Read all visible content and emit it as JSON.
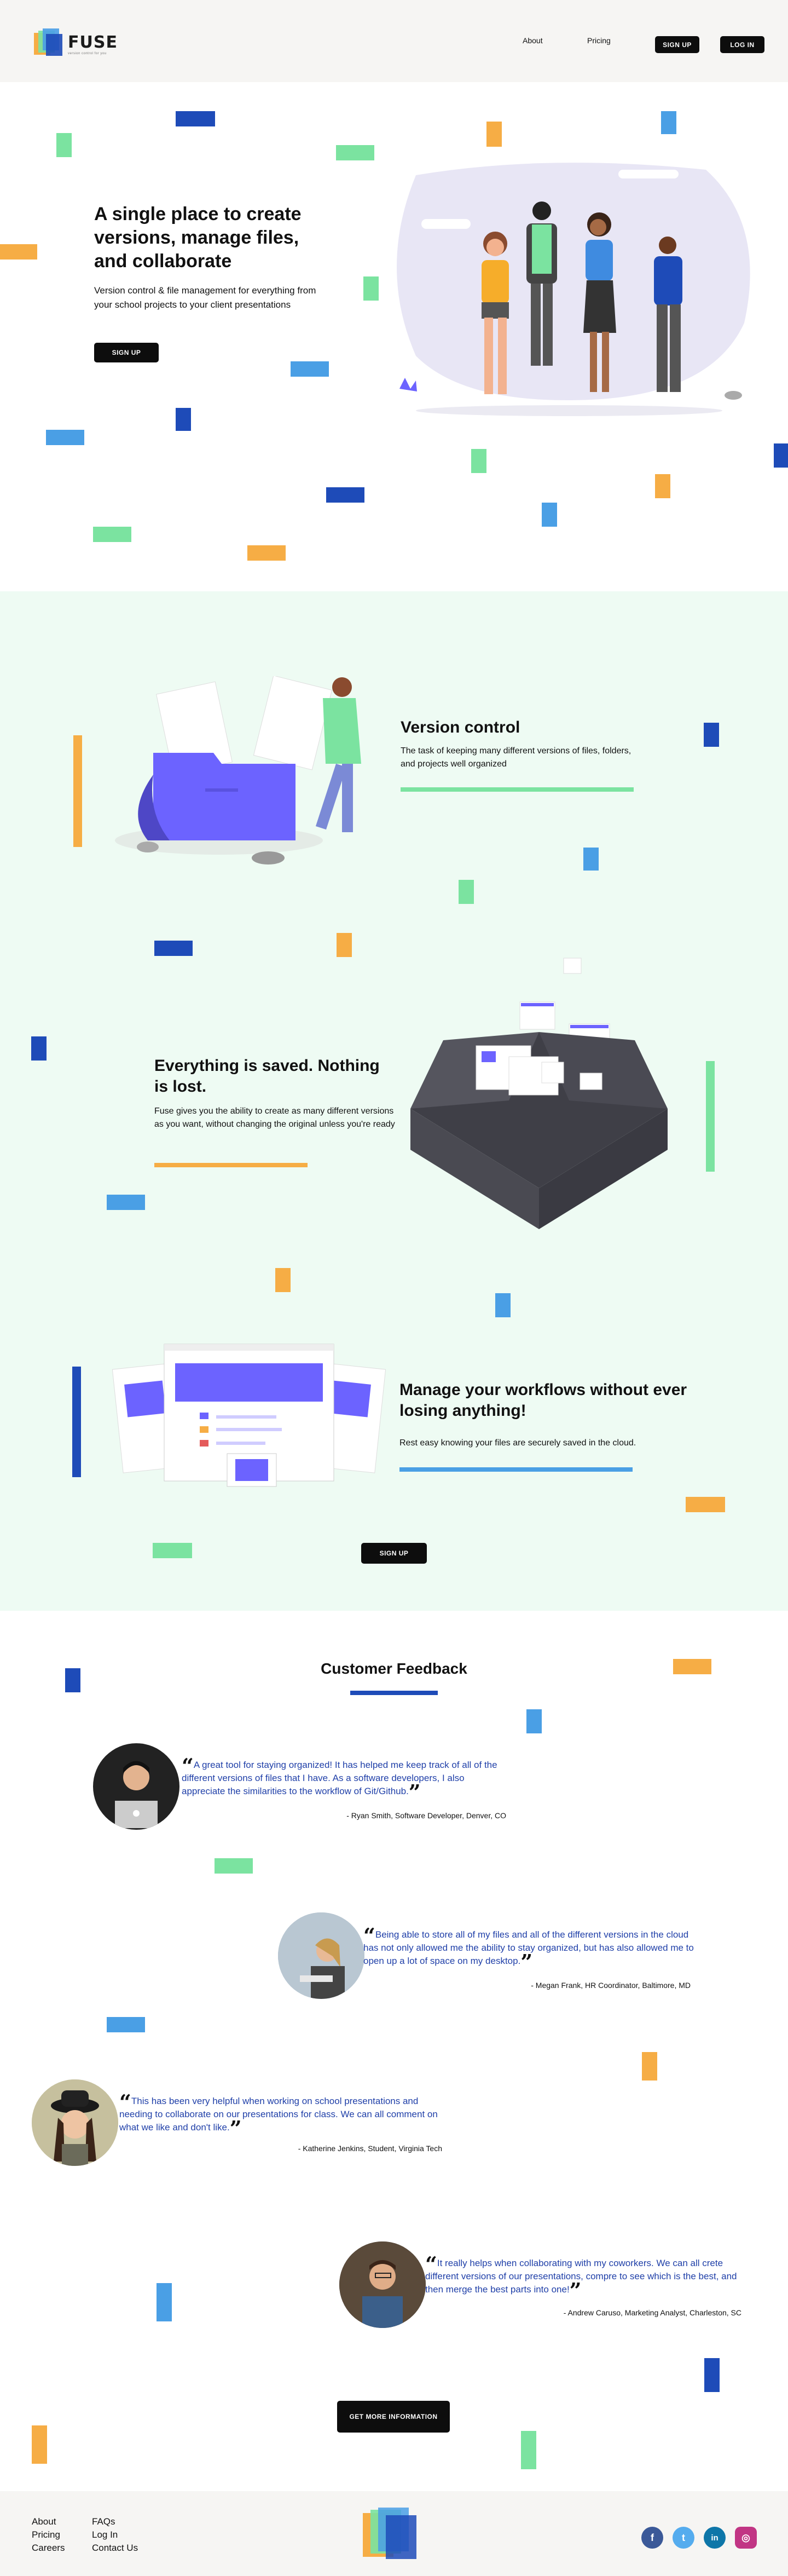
{
  "header": {
    "logo_text": "FUSE",
    "logo_tagline": "version control for you",
    "nav_about": "About",
    "nav_pricing": "Pricing",
    "signup_label": "SIGN UP",
    "login_label": "LOG IN"
  },
  "hero": {
    "title": "A single place to create versions, manage files, and collaborate",
    "subtitle": "Version control & file management for everything from your school projects to your client presentations",
    "cta_label": "SIGN UP"
  },
  "features": [
    {
      "title": "Version control",
      "description": "The task of keeping many different versions of files, folders, and projects well organized"
    },
    {
      "title": "Everything is saved. Nothing is lost.",
      "description": "Fuse gives you the ability to create as many different versions as you want, without changing the original unless you're ready"
    },
    {
      "title": "Manage your workflows without ever losing anything!",
      "description": "Rest easy knowing your files are securely saved in the cloud."
    }
  ],
  "features_cta": "SIGN UP",
  "feedback": {
    "title": "Customer Feedback",
    "items": [
      {
        "quote": "A great tool for staying organized! It has helped me keep track of all of the different versions of files that I have. As a software developers, I also appreciate the similarities to the workflow of Git/Github.",
        "author": "- Ryan Smith, Software Developer, Denver, CO"
      },
      {
        "quote": "Being able to store all of my files and all of the different versions in the cloud has not only allowed me the ability to stay organized, but has also allowed me to open up a lot of space on my desktop.",
        "author": "- Megan Frank, HR Coordinator, Baltimore, MD"
      },
      {
        "quote": "This has been very helpful when working on school presentations and needing to collaborate on our presentations for class. We can all comment on what we like and don't like.",
        "author": "- Katherine Jenkins, Student, Virginia Tech"
      },
      {
        "quote": "It really helps when collaborating with my coworkers. We can all crete different versions of our presentations, compre to see which is the best, and then merge the best parts into one!",
        "author": "- Andrew Caruso, Marketing Analyst, Charleston, SC"
      }
    ],
    "cta_label": "GET MORE INFORMATION"
  },
  "footer": {
    "col1": [
      "About",
      "Pricing",
      "Careers"
    ],
    "col2": [
      "FAQs",
      "Log In",
      "Contact Us"
    ],
    "social": [
      {
        "icon": "facebook-icon",
        "glyph": "f",
        "color": "#3b5998"
      },
      {
        "icon": "twitter-icon",
        "glyph": "t",
        "color": "#55acee"
      },
      {
        "icon": "linkedin-icon",
        "glyph": "in",
        "color": "#0e76a8"
      },
      {
        "icon": "instagram-icon",
        "glyph": "◎",
        "color": "#c13584"
      }
    ]
  },
  "colors": {
    "blue": "#1e4bb8",
    "light_blue": "#4a9fe5",
    "green": "#7be3a0",
    "orange": "#f6ad45",
    "purple": "#6c63ff",
    "button": "#0d0d0d",
    "quote_text": "#1f3fa8"
  }
}
